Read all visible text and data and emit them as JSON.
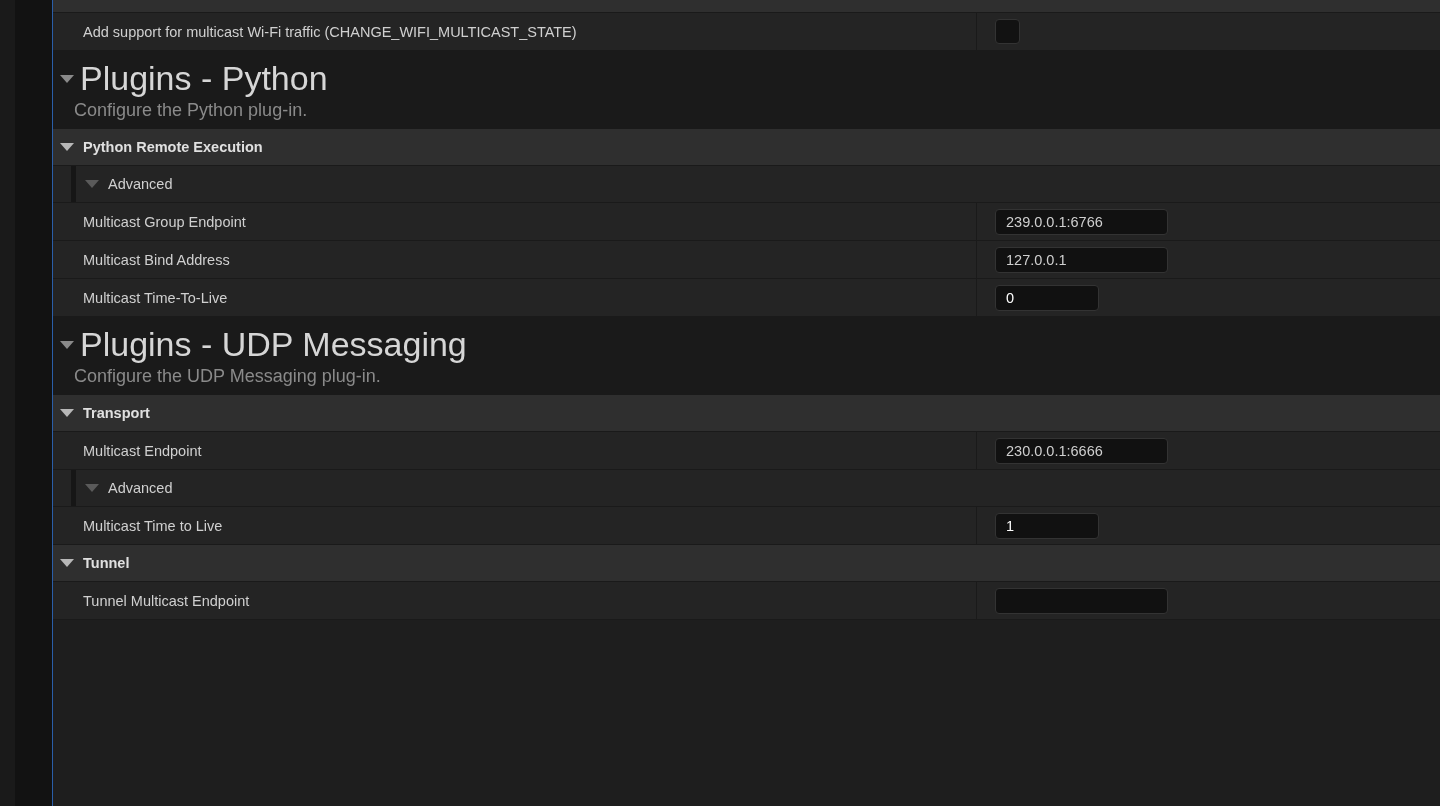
{
  "rows": [
    {
      "kind": "property",
      "label": "Add support for multicast Wi-Fi traffic (CHANGE_WIFI_MULTICAST_STATE)",
      "field": {
        "kind": "checkbox",
        "checked": false
      }
    },
    {
      "kind": "section",
      "title": "Plugins - Python",
      "description": "Configure the Python plug-in.",
      "expanded": true
    },
    {
      "kind": "category",
      "label": "Python Remote Execution",
      "expanded": true
    },
    {
      "kind": "subcategory",
      "label": "Advanced",
      "expanded": true
    },
    {
      "kind": "property",
      "label": "Multicast Group Endpoint",
      "field": {
        "kind": "text",
        "value": "239.0.0.1:6766"
      }
    },
    {
      "kind": "property",
      "label": "Multicast Bind Address",
      "field": {
        "kind": "text",
        "value": "127.0.0.1"
      }
    },
    {
      "kind": "property",
      "label": "Multicast Time-To-Live",
      "field": {
        "kind": "number",
        "value": "0"
      }
    },
    {
      "kind": "section",
      "title": "Plugins - UDP Messaging",
      "description": "Configure the UDP Messaging plug-in.",
      "expanded": true
    },
    {
      "kind": "category",
      "label": "Transport",
      "expanded": true
    },
    {
      "kind": "property",
      "label": "Multicast Endpoint",
      "field": {
        "kind": "text",
        "value": "230.0.0.1:6666"
      }
    },
    {
      "kind": "subcategory",
      "label": "Advanced",
      "expanded": true
    },
    {
      "kind": "property",
      "label": "Multicast Time to Live",
      "field": {
        "kind": "number",
        "value": "1"
      }
    },
    {
      "kind": "category",
      "label": "Tunnel",
      "expanded": true
    },
    {
      "kind": "property",
      "label": "Tunnel Multicast Endpoint",
      "field": {
        "kind": "text"
      }
    }
  ]
}
